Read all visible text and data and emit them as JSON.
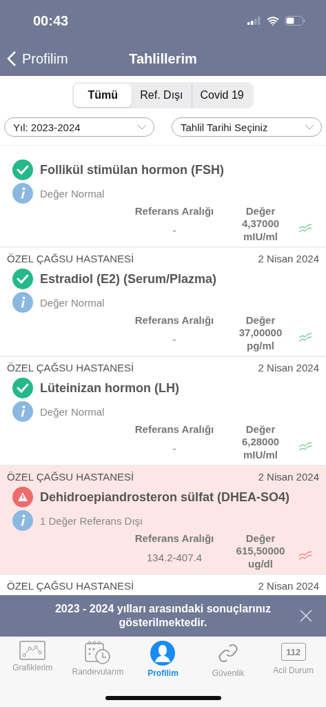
{
  "status_bar": {
    "time": "00:43"
  },
  "nav": {
    "back": "Profilim",
    "title": "Tahlillerim"
  },
  "segments": [
    {
      "label": "Tümü",
      "selected": true
    },
    {
      "label": "Ref. Dışı",
      "selected": false
    },
    {
      "label": "Covid 19",
      "selected": false
    }
  ],
  "filters": [
    {
      "value": "Yıl: 2023-2024"
    },
    {
      "value": "Tahlil Tarihi Seçiniz"
    }
  ],
  "results": [
    {
      "out_of_range": false,
      "name": "Follikül stimülan hormon (FSH)",
      "note": "Değer Normal",
      "range_label": "Referans Aralığı",
      "range": "-",
      "value_label": "Değer",
      "value": "4,37000",
      "unit": "mIU/ml"
    },
    {
      "hospital": "ÖZEL ÇAĞSU HASTANESİ",
      "date": "2 Nisan 2024",
      "out_of_range": false,
      "name": "Estradiol (E2) (Serum/Plazma)",
      "note": "Değer Normal",
      "range_label": "Referans Aralığı",
      "range": "-",
      "value_label": "Değer",
      "value": "37,00000",
      "unit": "pg/ml"
    },
    {
      "hospital": "ÖZEL ÇAĞSU HASTANESİ",
      "date": "2 Nisan 2024",
      "out_of_range": false,
      "name": "Lüteinizan hormon (LH)",
      "note": "Değer Normal",
      "range_label": "Referans Aralığı",
      "range": "-",
      "value_label": "Değer",
      "value": "6,28000",
      "unit": "mIU/ml"
    },
    {
      "hospital": "ÖZEL ÇAĞSU HASTANESİ",
      "date": "2 Nisan 2024",
      "out_of_range": true,
      "name": "Dehidroepiandrosteron sülfat (DHEA-SO4)",
      "note": "1 Değer Referans Dışı",
      "range_label": "Referans Aralığı",
      "range": "134.2-407.4",
      "value_label": "Değer",
      "value": "615,50000",
      "unit": "ug/dl"
    },
    {
      "hospital": "ÖZEL ÇAĞSU HASTANESİ",
      "date": "2 Nisan 2024"
    }
  ],
  "banner": {
    "text": "2023 - 2024 yılları arasındaki sonuçlarınız gösterilmektedir."
  },
  "tabs": [
    {
      "kind": "chart",
      "label": "Grafiklerim",
      "selected": false
    },
    {
      "kind": "calendar",
      "label": "Randevularım",
      "selected": false
    },
    {
      "kind": "person",
      "label": "Profilim",
      "selected": true
    },
    {
      "kind": "link",
      "label": "Güvenlik",
      "selected": false
    },
    {
      "kind": "emergency",
      "label": "Acil Durum",
      "selected": false,
      "badge": "112"
    }
  ]
}
